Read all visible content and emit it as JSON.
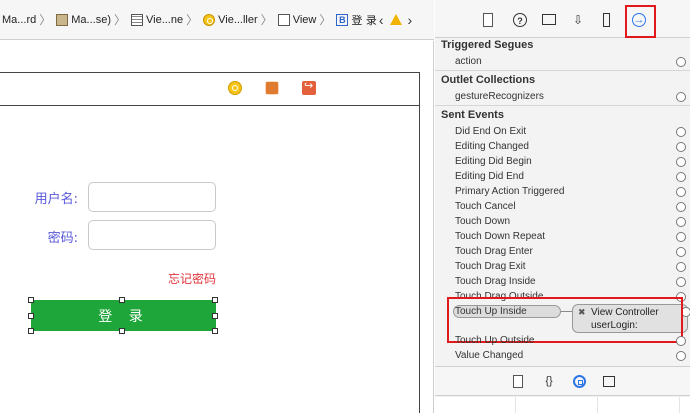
{
  "jumpbar": {
    "crumbs": [
      {
        "label": "Ma...rd",
        "icon": "file-icon"
      },
      {
        "label": "Ma...se)",
        "icon": "storyboard-icon"
      },
      {
        "label": "Vie...ne",
        "icon": "scene-icon"
      },
      {
        "label": "Vie...ller",
        "icon": "view-controller-icon"
      },
      {
        "label": "View",
        "icon": "view-icon"
      },
      {
        "label": "登 录",
        "icon": "button-icon",
        "icon_text": "B"
      }
    ],
    "back_glyph": "‹",
    "forward_glyph": "›",
    "warning_color": "#f2b200"
  },
  "canvas": {
    "username_label": "用户名:",
    "password_label": "密码:",
    "forgot_link": "忘记密码",
    "login_button": "登 录",
    "login_button_color": "#1fa63a",
    "forgot_color": "#e0333a",
    "label_color": "#5757d9"
  },
  "inspector": {
    "tab_glyphs": {
      "help": "?",
      "attributes": "⇩",
      "connections": "→"
    },
    "triggered_segues_header": "Triggered Segues",
    "triggered_segues": [
      "action"
    ],
    "outlet_collections_header": "Outlet Collections",
    "outlet_collections": [
      "gestureRecognizers"
    ],
    "sent_events_header": "Sent Events",
    "sent_events": [
      "Did End On Exit",
      "Editing Changed",
      "Editing Did Begin",
      "Editing Did End",
      "Primary Action Triggered",
      "Touch Cancel",
      "Touch Down",
      "Touch Down Repeat",
      "Touch Drag Enter",
      "Touch Drag Exit",
      "Touch Drag Inside",
      "Touch Drag Outside",
      "Touch Up Inside",
      "Touch Up Outside",
      "Value Changed"
    ],
    "connection": {
      "event": "Touch Up Inside",
      "remove_glyph": "✖",
      "target": "View Controller",
      "action": "userLogin:"
    },
    "highlight_color": "#e01a1a"
  },
  "library": {
    "code_glyph": "{}"
  }
}
